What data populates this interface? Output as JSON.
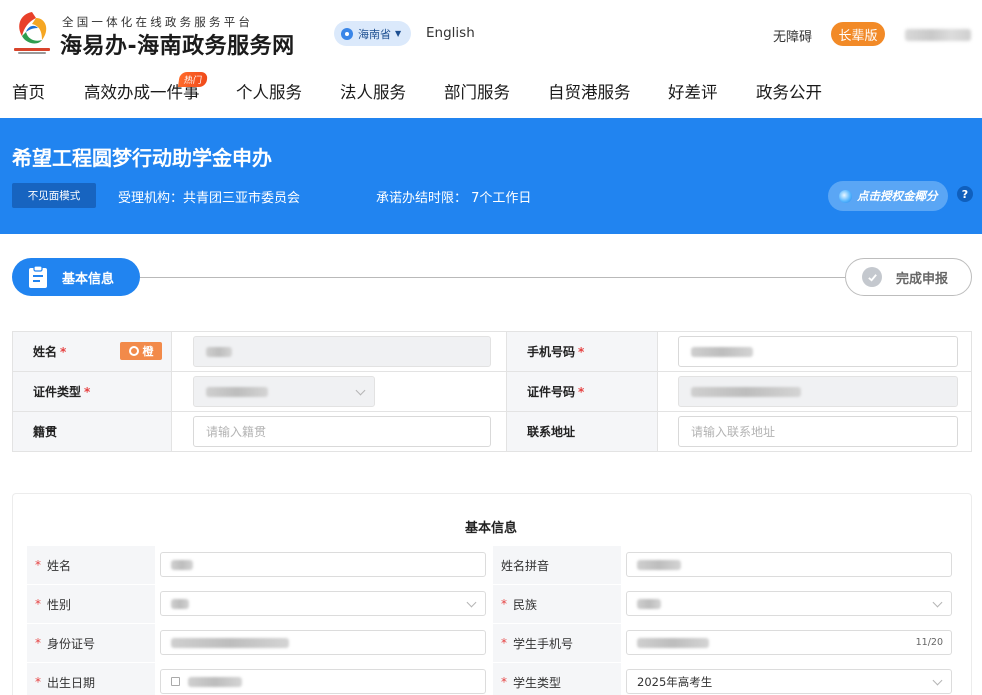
{
  "header": {
    "site_subtitle": "全国一体化在线政务服务平台",
    "site_title": "海易办-海南政务服务网",
    "region": "海南省",
    "english_label": "English",
    "accessibility_label": "无障碍",
    "elder_mode_label": "长辈版"
  },
  "nav": {
    "items": [
      "首页",
      "高效办成一件事",
      "个人服务",
      "法人服务",
      "部门服务",
      "自贸港服务",
      "好差评",
      "政务公开"
    ],
    "hot_badge": "热门"
  },
  "banner": {
    "title": "希望工程圆梦行动助学金申办",
    "mode_chip": "不见面模式",
    "agency": "受理机构：共青团三亚市委员会",
    "deadline": "承诺办结时限： 7个工作日",
    "auth_button": "点击授权金椰分",
    "help": "?"
  },
  "steps": {
    "current": "基本信息",
    "final": "完成申报"
  },
  "applicant_table": {
    "required_mark": "*",
    "name_label": "姓名",
    "name_tag": "橙",
    "phone_label": "手机号码",
    "id_type_label": "证件类型",
    "id_number_label": "证件号码",
    "native_place_label": "籍贯",
    "native_place_placeholder": "请输入籍贯",
    "address_label": "联系地址",
    "address_placeholder": "请输入联系地址"
  },
  "basic_info_form": {
    "title": "基本信息",
    "required_mark": "*",
    "fields": {
      "name": "姓名",
      "name_pinyin": "姓名拼音",
      "gender": "性别",
      "ethnicity": "民族",
      "id_number": "身份证号",
      "student_phone": "学生手机号",
      "student_phone_counter": "11/20",
      "birth_date": "出生日期",
      "student_type": "学生类型",
      "student_type_value": "2025年高考生"
    }
  },
  "colors": {
    "brand_blue": "#2184f0",
    "accent_orange": "#f28a27",
    "required_red": "#e64242"
  },
  "icons": [
    "logo-icon",
    "location-pin-icon",
    "caret-down-icon",
    "jinye-coin-icon",
    "help-icon",
    "clipboard-icon",
    "check-circle-icon",
    "orange-app-icon",
    "calendar-icon",
    "chevron-down-icon"
  ]
}
